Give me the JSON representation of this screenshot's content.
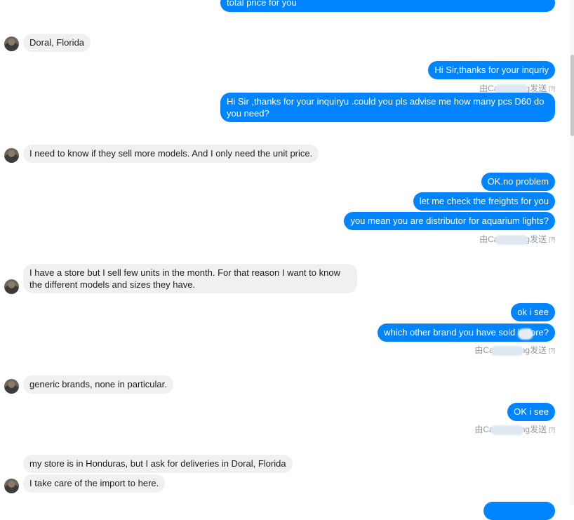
{
  "meta_label": {
    "prefix": "由Ca",
    "suffix_g": "g发送",
    "suffix_ng": "ng发送",
    "help": "[?]"
  },
  "messages": {
    "m0": "total price for you",
    "m1": "Doral, Florida",
    "m2": "Hi Sir,thanks for your inquriy",
    "m3": "Hi Sir ,thanks for your inquiryu .could you pls advise me how many pcs D60 do you need?",
    "m4": "I need to know if they sell more models. And I only need the unit price.",
    "m5": "OK.no problem",
    "m6": "let me check the freights for you",
    "m7": "you mean you are distributor for aquarium lights?",
    "m8": "I have a store but I sell few units in the month. For that reason I want to know the different models and sizes they have.",
    "m9": "ok i see",
    "m10": "which other brand you have sold before?",
    "m11": "generic brands, none in particular.",
    "m12": "OK i see",
    "m13": "my store is in Honduras, but I ask for deliveries in Doral, Florida",
    "m14": "I take care of the import to here."
  },
  "colors": {
    "outgoing_bubble": "#0084ff",
    "incoming_bubble": "#f1f0f0",
    "meta_text": "#90949c"
  },
  "icons": {
    "avatar": "user-avatar-photo"
  }
}
